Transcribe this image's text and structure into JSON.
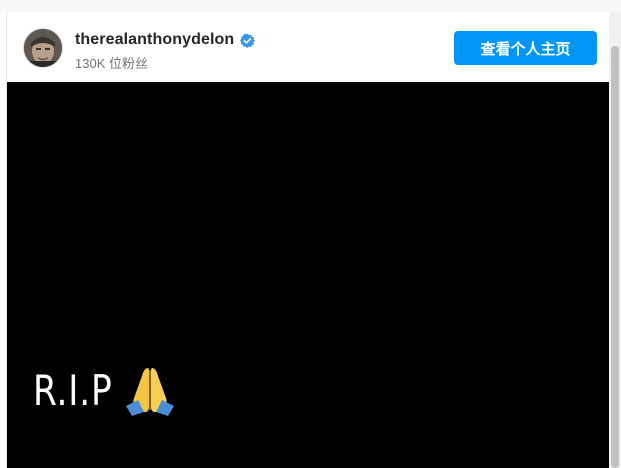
{
  "post": {
    "username": "therealanthonydelon",
    "verified": true,
    "followers_text": "130K 位粉丝",
    "view_profile_label": "查看个人主页",
    "media_caption": "R.I.P",
    "media_emoji": "folded-hands-icon"
  },
  "colors": {
    "button": "#0095f6",
    "verified_badge": "#3897f0",
    "media_background": "#000000"
  }
}
